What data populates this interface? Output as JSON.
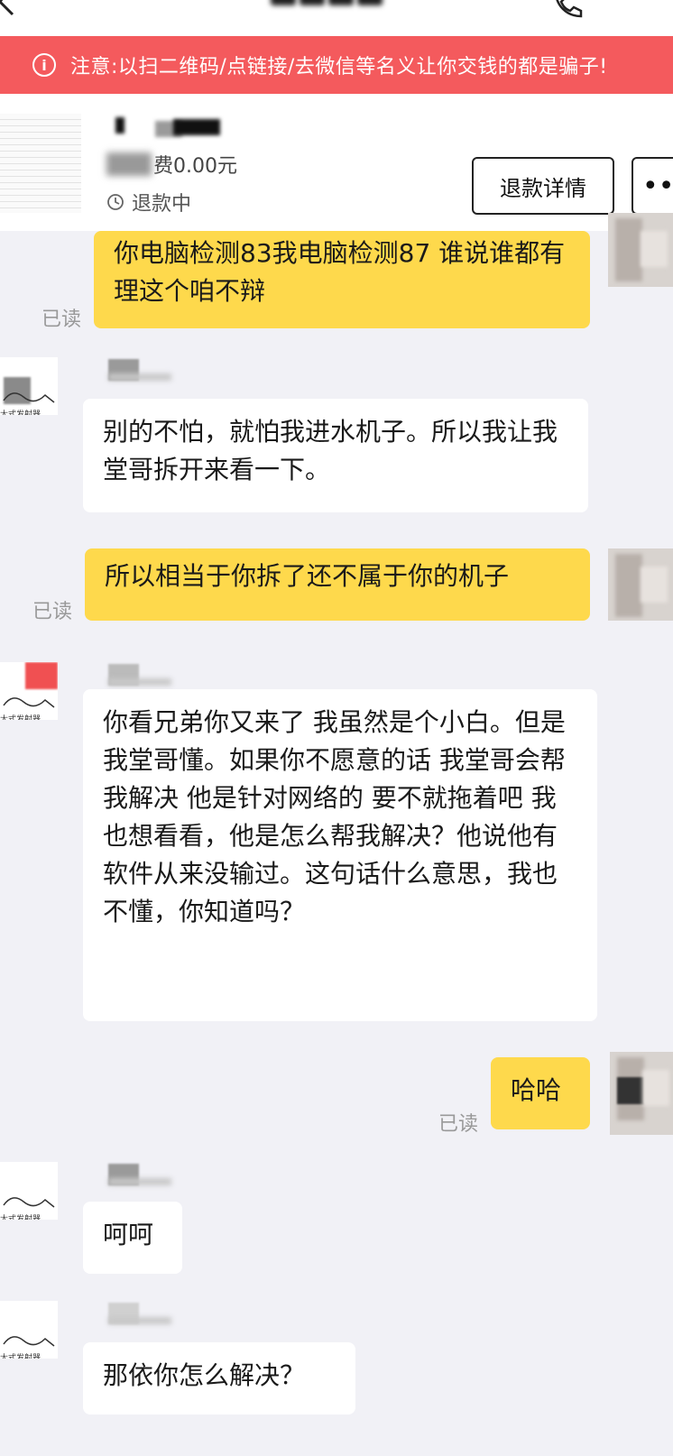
{
  "header": {
    "title": "",
    "back_icon": "chevron-left-icon",
    "call_icon": "phone-icon"
  },
  "warning": {
    "icon": "info-circle-icon",
    "icon_glyph": "i",
    "text": "注意:以扫二维码/点链接/去微信等名义让你交钱的都是骗子!"
  },
  "order": {
    "price_text": "费0.00元",
    "status_text": "退款中",
    "refund_button": "退款详情",
    "more_button": "•••"
  },
  "messages": [
    {
      "side": "me",
      "read": "已读",
      "text": "你电脑检测83我电脑检测87 谁说谁都有理这个咱不辩"
    },
    {
      "side": "other",
      "text": "别的不怕，就怕我进水机子。所以我让我堂哥拆开来看一下。"
    },
    {
      "side": "me",
      "read": "已读",
      "text": "所以相当于你拆了还不属于你的机子"
    },
    {
      "side": "other",
      "text": "你看兄弟你又来了 我虽然是个小白。但是我堂哥懂。如果你不愿意的话 我堂哥会帮我解决 他是针对网络的 要不就拖着吧 我也想看看，他是怎么帮我解决？他说他有软件从来没输过。这句话什么意思，我也不懂，你知道吗？"
    },
    {
      "side": "me",
      "read": "已读",
      "text": "哈哈"
    },
    {
      "side": "other",
      "text": "呵呵"
    },
    {
      "side": "other",
      "text": "那依你怎么解决？"
    }
  ],
  "colors": {
    "warning_bg": "#f45a5d",
    "my_bubble": "#fed94c",
    "other_bubble": "#ffffff",
    "background": "#f1f1f6"
  }
}
